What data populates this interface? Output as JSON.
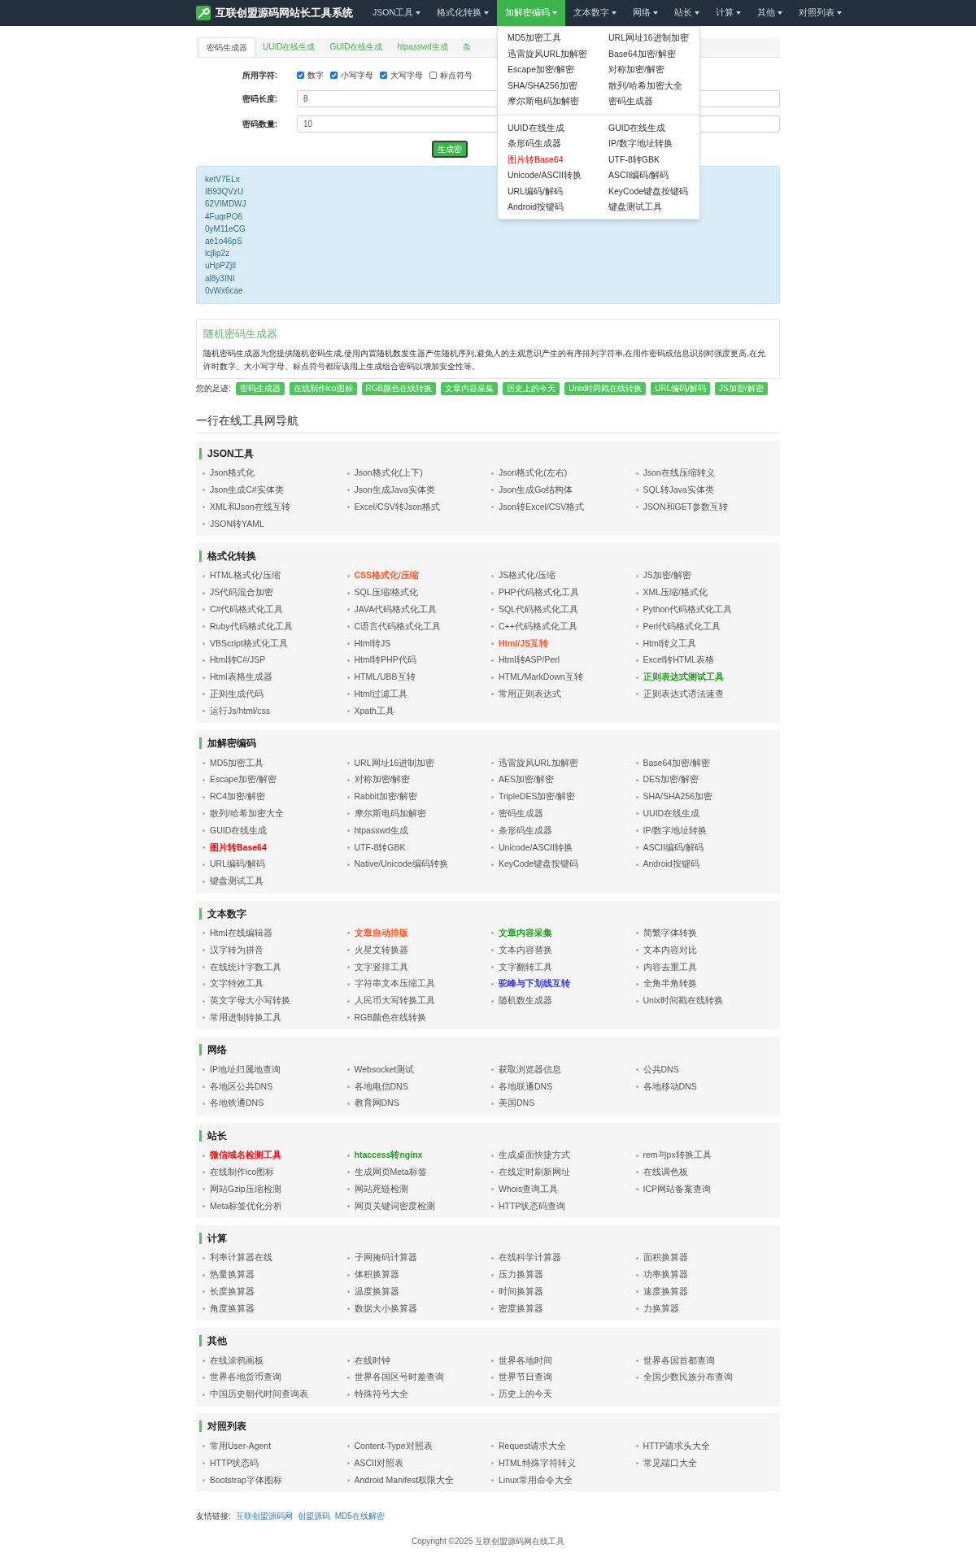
{
  "brand": "互联创盟源码网站长工具系统",
  "nav": [
    {
      "label": "JSON工具",
      "selected": false
    },
    {
      "label": "格式化转换",
      "selected": false
    },
    {
      "label": "加解密编码",
      "selected": true
    },
    {
      "label": "文本数字",
      "selected": false
    },
    {
      "label": "网络",
      "selected": false
    },
    {
      "label": "站长",
      "selected": false
    },
    {
      "label": "计算",
      "selected": false
    },
    {
      "label": "其他",
      "selected": false
    },
    {
      "label": "对照列表",
      "selected": false
    }
  ],
  "dropdown": {
    "groups": [
      [
        {
          "label": "MD5加密工具"
        },
        {
          "label": "URL网址16进制加密"
        },
        {
          "label": "迅雷旋风URL加解密"
        },
        {
          "label": "Base64加密/解密"
        },
        {
          "label": "Escape加密/解密"
        },
        {
          "label": "对称加密/解密"
        },
        {
          "label": "SHA/SHA256加密"
        },
        {
          "label": "散列/哈希加密大全"
        },
        {
          "label": "摩尔斯电码加解密"
        },
        {
          "label": "密码生成器"
        }
      ],
      [
        {
          "label": "UUID在线生成"
        },
        {
          "label": "GUID在线生成"
        },
        {
          "label": "条形码生成器"
        },
        {
          "label": "IP/数字地址转换"
        },
        {
          "label": "图片转Base64",
          "color": "#ff0000"
        },
        {
          "label": "UTF-8转GBK"
        },
        {
          "label": "Unicode/ASCII转换"
        },
        {
          "label": "ASCII编码/解码"
        },
        {
          "label": "URL编码/解码"
        },
        {
          "label": "KeyCode键盘按键码"
        },
        {
          "label": "Android按键码"
        },
        {
          "label": "键盘测试工具"
        }
      ]
    ]
  },
  "tabs": [
    {
      "label": "密码生成器",
      "selected": true
    },
    {
      "label": "UUID在线生成",
      "selected": false
    },
    {
      "label": "GUID在线生成",
      "selected": false
    },
    {
      "label": "htpasswd生成",
      "selected": false
    },
    {
      "label": "条",
      "selected": false
    }
  ],
  "form": {
    "charset_label": "所用字符:",
    "charsets": [
      {
        "label": "数字",
        "checked": true
      },
      {
        "label": "小写字母",
        "checked": true
      },
      {
        "label": "大写字母",
        "checked": true
      },
      {
        "label": "标点符号",
        "checked": false
      }
    ],
    "length_label": "密码长度:",
    "length": "8",
    "count_label": "密码数量:",
    "count": "10",
    "button": "生成密"
  },
  "passwords": [
    "ketV7ELx",
    "IB93QVzU",
    "62VIMDWJ",
    "4FuqrPO6",
    "0yM11eCG",
    "ae1o46pS",
    "lcjlip2z",
    "uHpPZjlI",
    "al8y3INI",
    "0vWx6cae"
  ],
  "about": {
    "title": "随机密码生成器",
    "text": "随机密码生成器为您提供随机密码生成,使用内置随机数发生器产生随机序列,避免人的主观意识产生的有序排列字符串,在用作密码或信息识别时强度更高,在允许时数字、大小写字母、标点符号都应该用上生成组合密码以增加安全性等。"
  },
  "footprints": {
    "label": "您的足迹:",
    "tags": [
      "密码生成器",
      "在线制作ico图标",
      "RGB颜色在线转换",
      "文章内容采集",
      "历史上的今天",
      "Unix时间戳在线转换",
      "URL编码/解码",
      "JS加密/解密"
    ]
  },
  "nav_heading": "一行在线工具网导航",
  "sections": [
    {
      "title": "JSON工具",
      "items": [
        {
          "label": "Json格式化"
        },
        {
          "label": "Json格式化(上下)"
        },
        {
          "label": "Json格式化(左右)"
        },
        {
          "label": "Json在线压缩转义"
        },
        {
          "label": "Json生成C#实体类"
        },
        {
          "label": "Json生成Java实体类"
        },
        {
          "label": "Json生成Go结构体"
        },
        {
          "label": "SQL转Java实体类"
        },
        {
          "label": "XML和Json在线互转"
        },
        {
          "label": "Excel/CSV转Json格式"
        },
        {
          "label": "Json转Excel/CSV格式"
        },
        {
          "label": "JSON和GET参数互转"
        },
        {
          "label": "JSON转YAML"
        }
      ]
    },
    {
      "title": "格式化转换",
      "items": [
        {
          "label": "HTML格式化/压缩"
        },
        {
          "label": "CSS格式化/压缩",
          "color": "#ff5722"
        },
        {
          "label": "JS格式化/压缩"
        },
        {
          "label": "JS加密/解密"
        },
        {
          "label": "JS代码混合加密"
        },
        {
          "label": "SQL压缩/格式化"
        },
        {
          "label": "PHP代码格式化工具"
        },
        {
          "label": "XML压缩/格式化"
        },
        {
          "label": "C#代码格式化工具"
        },
        {
          "label": "JAVA代码格式化工具"
        },
        {
          "label": "SQL代码格式化工具"
        },
        {
          "label": "Python代码格式化工具"
        },
        {
          "label": "Ruby代码格式化工具"
        },
        {
          "label": "C语言代码格式化工具"
        },
        {
          "label": "C++代码格式化工具"
        },
        {
          "label": "Perl代码格式化工具"
        },
        {
          "label": "VBScript格式化工具"
        },
        {
          "label": "Html转JS"
        },
        {
          "label": "Html/JS互转",
          "color": "#ff5722"
        },
        {
          "label": "Html转义工具"
        },
        {
          "label": "Html转C#/JSP"
        },
        {
          "label": "Html转PHP代码"
        },
        {
          "label": "Html转ASP/Perl"
        },
        {
          "label": "Excel转HTML表格"
        },
        {
          "label": "Html表格生成器"
        },
        {
          "label": "HTML/UBB互转"
        },
        {
          "label": "HTML/MarkDown互转"
        },
        {
          "label": "正则表达式测试工具",
          "color": "#1e9e1e"
        },
        {
          "label": "正则生成代码"
        },
        {
          "label": "Html过滤工具"
        },
        {
          "label": "常用正则表达式"
        },
        {
          "label": "正则表达式语法速查"
        },
        {
          "label": "运行Js/html/css"
        },
        {
          "label": "Xpath工具"
        }
      ]
    },
    {
      "title": "加解密编码",
      "items": [
        {
          "label": "MD5加密工具"
        },
        {
          "label": "URL网址16进制加密"
        },
        {
          "label": "迅雷旋风URL加解密"
        },
        {
          "label": "Base64加密/解密"
        },
        {
          "label": "Escape加密/解密"
        },
        {
          "label": "对称加密/解密"
        },
        {
          "label": "AES加密/解密"
        },
        {
          "label": "DES加密/解密"
        },
        {
          "label": "RC4加密/解密"
        },
        {
          "label": "Rabbit加密/解密"
        },
        {
          "label": "TripleDES加密/解密"
        },
        {
          "label": "SHA/SHA256加密"
        },
        {
          "label": "散列/哈希加密大全"
        },
        {
          "label": "摩尔斯电码加解密"
        },
        {
          "label": "密码生成器"
        },
        {
          "label": "UUID在线生成"
        },
        {
          "label": "GUID在线生成"
        },
        {
          "label": "htpasswd生成"
        },
        {
          "label": "条形码生成器"
        },
        {
          "label": "IP/数字地址转换"
        },
        {
          "label": "图片转Base64",
          "color": "#ff0000"
        },
        {
          "label": "UTF-8转GBK"
        },
        {
          "label": "Unicode/ASCII转换"
        },
        {
          "label": "ASCII编码/解码"
        },
        {
          "label": "URL编码/解码"
        },
        {
          "label": "Native/Unicode编码转换"
        },
        {
          "label": "KeyCode键盘按键码"
        },
        {
          "label": "Android按键码"
        },
        {
          "label": "键盘测试工具"
        }
      ]
    },
    {
      "title": "文本数字",
      "items": [
        {
          "label": "Html在线编辑器"
        },
        {
          "label": "文章自动排版",
          "color": "#ff5722"
        },
        {
          "label": "文章内容采集",
          "color": "#1e9e1e"
        },
        {
          "label": "简繁字体转换"
        },
        {
          "label": "汉字转为拼音"
        },
        {
          "label": "火星文转换器"
        },
        {
          "label": "文本内容替换"
        },
        {
          "label": "文本内容对比"
        },
        {
          "label": "在线统计字数工具"
        },
        {
          "label": "文字竖排工具"
        },
        {
          "label": "文字翻转工具"
        },
        {
          "label": "内容去重工具"
        },
        {
          "label": "文字特效工具"
        },
        {
          "label": "字符串文本压缩工具"
        },
        {
          "label": "驼峰与下划线互转",
          "color": "#3333ee"
        },
        {
          "label": "全角半角转换"
        },
        {
          "label": "英文字母大小写转换"
        },
        {
          "label": "人民币大写转换工具"
        },
        {
          "label": "随机数生成器"
        },
        {
          "label": "Unix时间戳在线转换"
        },
        {
          "label": "常用进制转换工具"
        },
        {
          "label": "RGB颜色在线转换"
        }
      ]
    },
    {
      "title": "网络",
      "items": [
        {
          "label": "IP地址归属地查询"
        },
        {
          "label": "Websocket测试"
        },
        {
          "label": "获取浏览器信息"
        },
        {
          "label": "公共DNS"
        },
        {
          "label": "各地区公共DNS"
        },
        {
          "label": "各地电信DNS"
        },
        {
          "label": "各地联通DNS"
        },
        {
          "label": "各地移动DNS"
        },
        {
          "label": "各地铁通DNS"
        },
        {
          "label": "教育网DNS"
        },
        {
          "label": "美国DNS"
        }
      ]
    },
    {
      "title": "站长",
      "items": [
        {
          "label": "微信域名检测工具",
          "color": "#ff0000"
        },
        {
          "label": "htaccess转nginx",
          "color": "#1e9e1e"
        },
        {
          "label": "生成桌面快捷方式"
        },
        {
          "label": "rem与px转换工具"
        },
        {
          "label": "在线制作ico图标"
        },
        {
          "label": "生成网页Meta标签"
        },
        {
          "label": "在线定时刷新网址"
        },
        {
          "label": "在线调色板"
        },
        {
          "label": "网站Gzip压缩检测"
        },
        {
          "label": "网站死链检测"
        },
        {
          "label": "Whois查询工具"
        },
        {
          "label": "ICP网站备案查询"
        },
        {
          "label": "Meta标签优化分析"
        },
        {
          "label": "网页关键词密度检测"
        },
        {
          "label": "HTTP状态码查询"
        }
      ]
    },
    {
      "title": "计算",
      "items": [
        {
          "label": "利率计算器在线"
        },
        {
          "label": "子网掩码计算器"
        },
        {
          "label": "在线科学计算器"
        },
        {
          "label": "面积换算器"
        },
        {
          "label": "热量换算器"
        },
        {
          "label": "体积换算器"
        },
        {
          "label": "压力换算器"
        },
        {
          "label": "功率换算器"
        },
        {
          "label": "长度换算器"
        },
        {
          "label": "温度换算器"
        },
        {
          "label": "时间换算器"
        },
        {
          "label": "速度换算器"
        },
        {
          "label": "角度换算器"
        },
        {
          "label": "数据大小换算器"
        },
        {
          "label": "密度换算器"
        },
        {
          "label": "力换算器"
        }
      ]
    },
    {
      "title": "其他",
      "items": [
        {
          "label": "在线涂鸦画板"
        },
        {
          "label": "在线时钟"
        },
        {
          "label": "世界各地时间"
        },
        {
          "label": "世界各国首都查询"
        },
        {
          "label": "世界各地货币查询"
        },
        {
          "label": "世界各国区号时差查询"
        },
        {
          "label": "世界节日查询"
        },
        {
          "label": "全国少数民族分布查询"
        },
        {
          "label": "中国历史朝代时间查询表"
        },
        {
          "label": "特殊符号大全"
        },
        {
          "label": "历史上的今天"
        }
      ]
    },
    {
      "title": "对照列表",
      "items": [
        {
          "label": "常用User-Agent"
        },
        {
          "label": "Content-Type对照表"
        },
        {
          "label": "Request请求大全"
        },
        {
          "label": "HTTP请求头大全"
        },
        {
          "label": "HTTP状态码"
        },
        {
          "label": "ASCII对照表"
        },
        {
          "label": "HTML特殊字符转义"
        },
        {
          "label": "常见端口大全"
        },
        {
          "label": "Bootstrap字体图标"
        },
        {
          "label": "Android Manifest权限大全"
        },
        {
          "label": "Linux常用命令大全"
        }
      ]
    }
  ],
  "friend_links": {
    "label": "友情链接:",
    "links": [
      "互联创盟源码网",
      "创盟源码",
      "MD5在线解密"
    ]
  },
  "copyright": "Copyright ©2025 互联创盟源码网在线工具"
}
